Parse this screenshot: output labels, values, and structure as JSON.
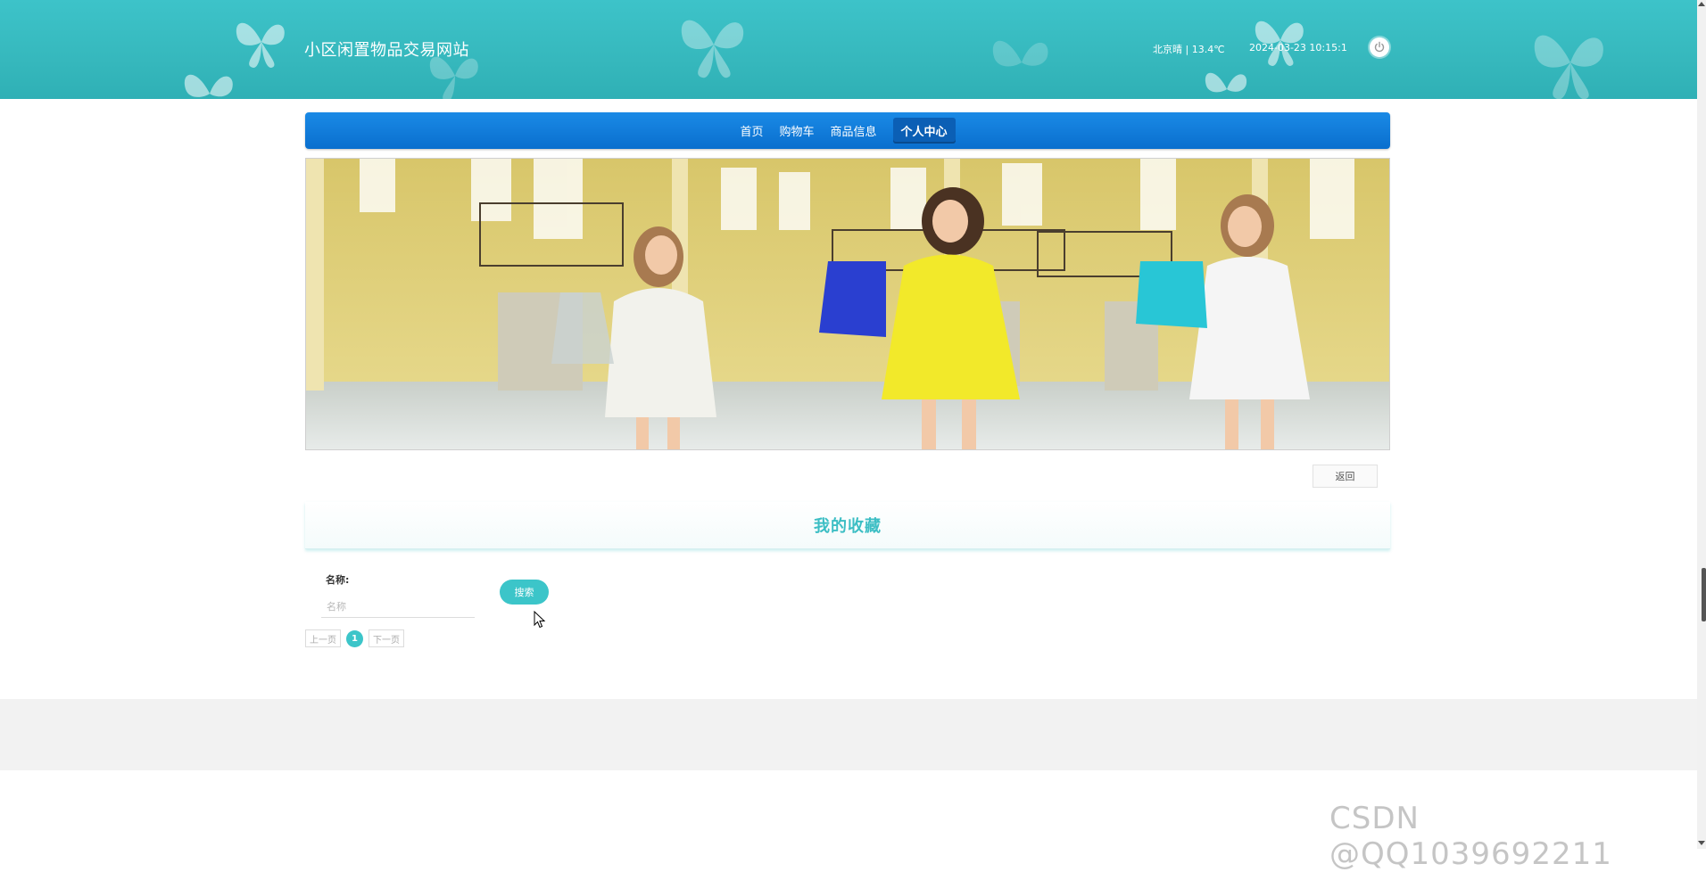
{
  "header": {
    "site_title": "小区闲置物品交易网站",
    "weather": "北京晴 | 13.4℃",
    "datetime": "2024-03-23   10:15:1"
  },
  "nav": {
    "items": [
      {
        "label": "首页"
      },
      {
        "label": "购物车"
      },
      {
        "label": "商品信息"
      },
      {
        "label": "个人中心",
        "active": true
      }
    ]
  },
  "page": {
    "back_label": "返回",
    "section_title": "我的收藏"
  },
  "search": {
    "label": "名称:",
    "placeholder": "名称",
    "button_label": "搜索"
  },
  "pagination": {
    "prev_label": "上一页",
    "current_page": "1",
    "next_label": "下一页"
  },
  "watermark": "CSDN @QQ1039692211",
  "colors": {
    "header_teal": "#3dc3c9",
    "nav_blue": "#0a6fce",
    "accent_teal": "#3cc5c9",
    "footer_gray": "#f2f2f2"
  }
}
